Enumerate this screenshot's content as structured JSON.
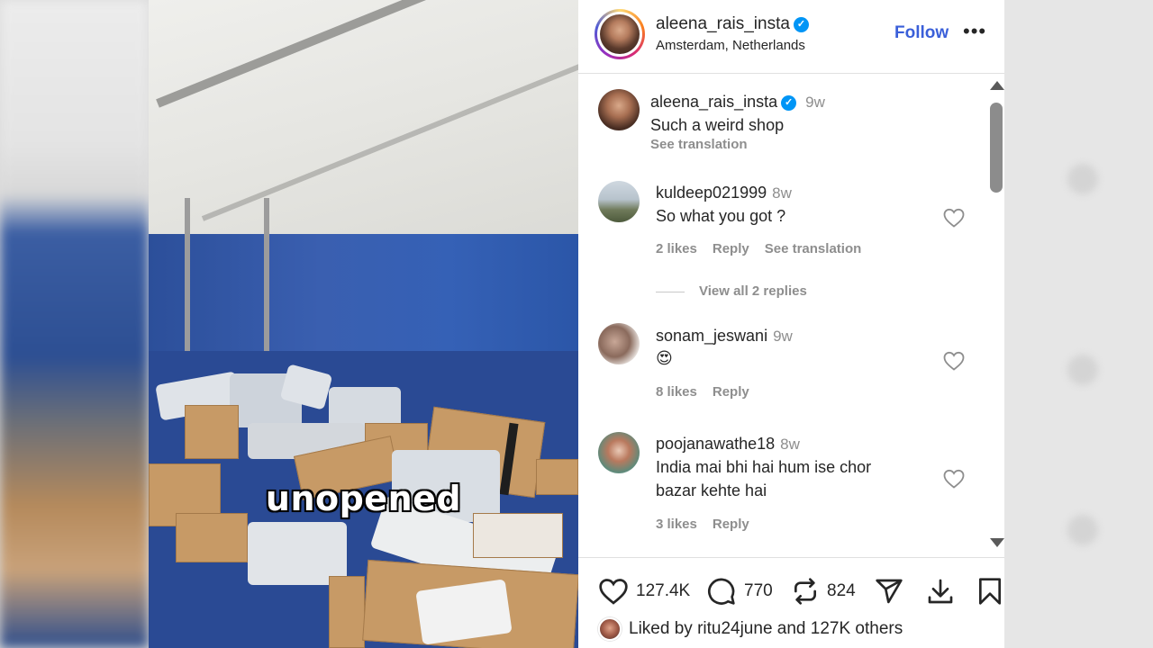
{
  "post": {
    "username": "aleena_rais_insta",
    "location": "Amsterdam, Netherlands",
    "follow_label": "Follow",
    "more_label": "•••",
    "verified_glyph": "✓"
  },
  "video": {
    "caption": "unopened"
  },
  "caption_comment": {
    "username": "aleena_rais_insta",
    "time": "9w",
    "text": "Such a weird shop",
    "see_translation": "See translation"
  },
  "comments": [
    {
      "username": "kuldeep021999",
      "time": "8w",
      "text": "So what you got ?",
      "likes": "2 likes",
      "reply": "Reply",
      "see_translation": "See translation",
      "view_replies": "View all 2 replies"
    },
    {
      "username": "sonam_jeswani",
      "time": "9w",
      "text": "😍",
      "likes": "8 likes",
      "reply": "Reply"
    },
    {
      "username": "poojanawathe18",
      "time": "8w",
      "text_line1": "India mai bhi hai hum ise chor",
      "text_line2": "bazar kehte hai",
      "likes": "3 likes",
      "reply": "Reply"
    }
  ],
  "actions": {
    "likes_count": "127.4K",
    "comments_count": "770",
    "reposts_count": "824"
  },
  "liked_by": {
    "prefix": "Liked by",
    "user": "ritu24june",
    "connector": "and",
    "others": "127K others"
  },
  "colors": {
    "follow": "#3a5fd9",
    "verified": "#0095f6",
    "text": "#262626",
    "muted": "#8e8e8e"
  },
  "icons": [
    "verified-badge-icon",
    "more-options-icon",
    "heart-icon",
    "comment-icon",
    "repost-icon",
    "share-icon",
    "download-icon",
    "bookmark-icon",
    "scroll-up-icon",
    "scroll-down-icon"
  ]
}
